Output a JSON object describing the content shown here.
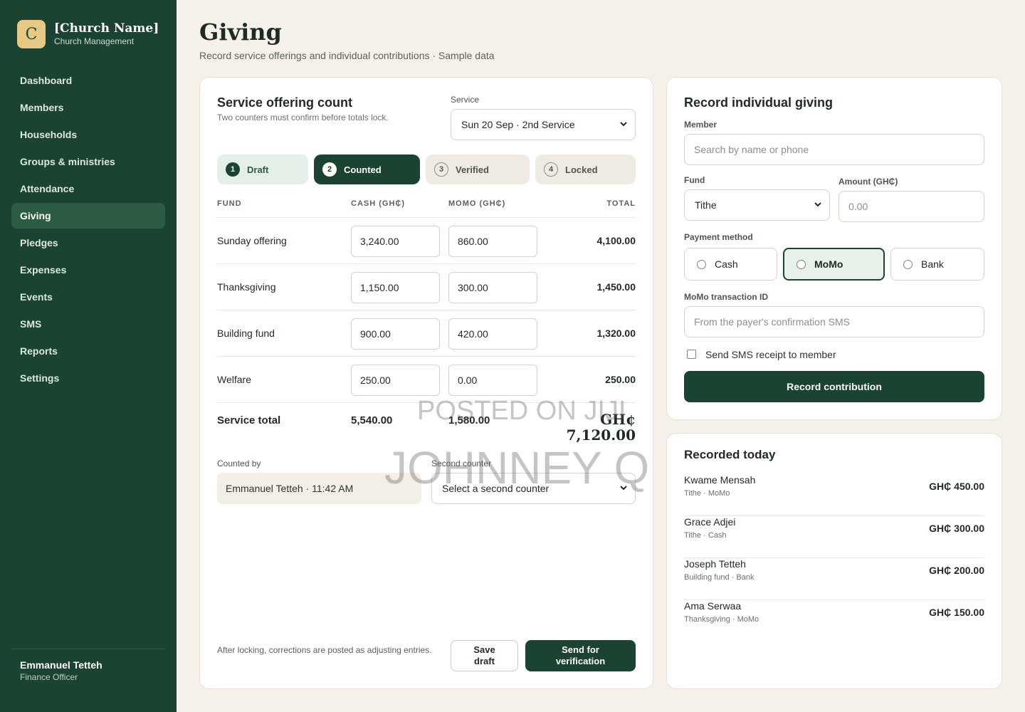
{
  "brand": {
    "mark": "C",
    "name": "[Church Name]",
    "subtitle": "Church Management"
  },
  "nav": [
    {
      "label": "Dashboard",
      "active": false
    },
    {
      "label": "Members",
      "active": false
    },
    {
      "label": "Households",
      "active": false
    },
    {
      "label": "Groups & ministries",
      "active": false
    },
    {
      "label": "Attendance",
      "active": false
    },
    {
      "label": "Giving",
      "active": true
    },
    {
      "label": "Pledges",
      "active": false
    },
    {
      "label": "Expenses",
      "active": false
    },
    {
      "label": "Events",
      "active": false
    },
    {
      "label": "SMS",
      "active": false
    },
    {
      "label": "Reports",
      "active": false
    },
    {
      "label": "Settings",
      "active": false
    }
  ],
  "user": {
    "name": "Emmanuel Tetteh",
    "role": "Finance Officer"
  },
  "page": {
    "title": "Giving",
    "subtitle": "Record service offerings and individual contributions · Sample data"
  },
  "offering": {
    "title": "Service offering count",
    "subtitle": "Two counters must confirm before totals lock.",
    "service_label": "Service",
    "service_value": "Sun 20 Sep · 2nd Service",
    "steps": [
      {
        "num": "1",
        "label": "Draft",
        "state": "done"
      },
      {
        "num": "2",
        "label": "Counted",
        "state": "current"
      },
      {
        "num": "3",
        "label": "Verified",
        "state": "todo"
      },
      {
        "num": "4",
        "label": "Locked",
        "state": "todo"
      }
    ],
    "columns": {
      "fund": "FUND",
      "cash": "CASH (GH₵)",
      "momo": "MOMO (GH₵)",
      "total": "TOTAL"
    },
    "rows": [
      {
        "fund": "Sunday offering",
        "cash": "3,240.00",
        "momo": "860.00",
        "total": "4,100.00"
      },
      {
        "fund": "Thanksgiving",
        "cash": "1,150.00",
        "momo": "300.00",
        "total": "1,450.00"
      },
      {
        "fund": "Building fund",
        "cash": "900.00",
        "momo": "420.00",
        "total": "1,320.00"
      },
      {
        "fund": "Welfare",
        "cash": "250.00",
        "momo": "0.00",
        "total": "250.00"
      }
    ],
    "total": {
      "label": "Service total",
      "cash": "5,540.00",
      "momo": "1,580.00",
      "currency": "GH¢",
      "grand": "7,120.00"
    },
    "counted_by_label": "Counted by",
    "counted_by_value": "Emmanuel Tetteh · 11:42 AM",
    "second_counter_label": "Second counter",
    "second_counter_value": "Select a second counter",
    "note": "After locking, corrections are posted as adjusting entries.",
    "save_label": "Save draft",
    "send_label": "Send for verification"
  },
  "watermark": {
    "line1": "POSTED ON JIJI",
    "line2": "JOHNNEY Q"
  },
  "record": {
    "title": "Record individual giving",
    "member_label": "Member",
    "member_placeholder": "Search by name or phone",
    "fund_label": "Fund",
    "fund_value": "Tithe",
    "amount_label": "Amount (GH₵)",
    "amount_placeholder": "0.00",
    "payment_label": "Payment method",
    "methods": [
      {
        "label": "Cash",
        "selected": false
      },
      {
        "label": "MoMo",
        "selected": true
      },
      {
        "label": "Bank",
        "selected": false
      }
    ],
    "txn_label": "MoMo transaction ID",
    "txn_placeholder": "From the payer's confirmation SMS",
    "sms_label": "Send SMS receipt to member",
    "submit_label": "Record contribution"
  },
  "recorded": {
    "title": "Recorded today",
    "items": [
      {
        "name": "Kwame Mensah",
        "meta": "Tithe · MoMo",
        "amount": "GH₵ 450.00"
      },
      {
        "name": "Grace Adjei",
        "meta": "Tithe · Cash",
        "amount": "GH₵ 300.00"
      },
      {
        "name": "Joseph Tetteh",
        "meta": "Building fund · Bank",
        "amount": "GH₵ 200.00"
      },
      {
        "name": "Ama Serwaa",
        "meta": "Thanksgiving · MoMo",
        "amount": "GH₵ 150.00"
      }
    ]
  }
}
